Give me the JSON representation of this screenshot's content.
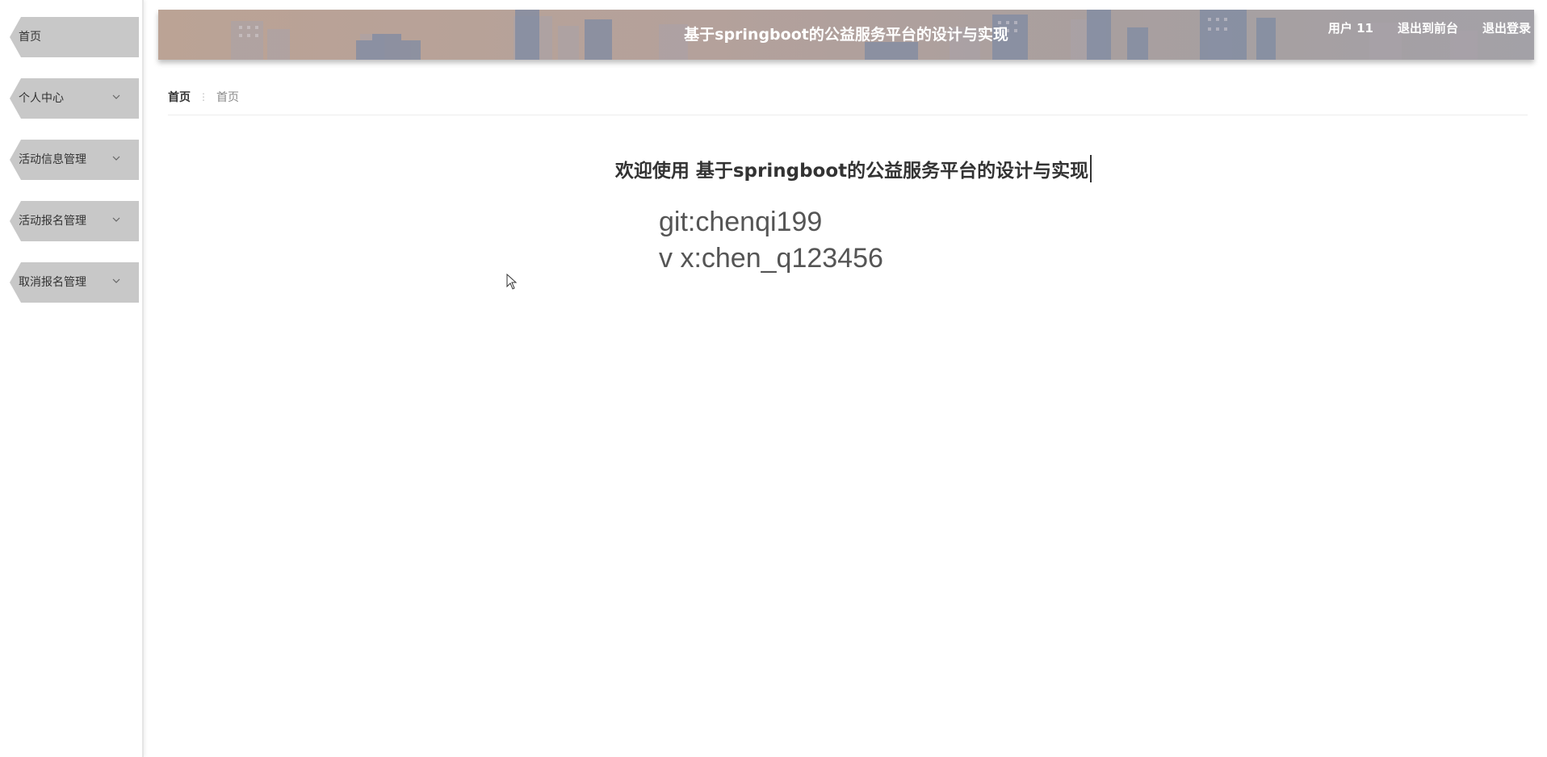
{
  "sidebar": {
    "items": [
      {
        "label": "首页",
        "expandable": false
      },
      {
        "label": "个人中心",
        "expandable": true
      },
      {
        "label": "活动信息管理",
        "expandable": true
      },
      {
        "label": "活动报名管理",
        "expandable": true
      },
      {
        "label": "取消报名管理",
        "expandable": true
      }
    ]
  },
  "header": {
    "title": "基于springboot的公益服务平台的设计与实现",
    "user_label": "用户 11",
    "back_to_front_label": "退出到前台",
    "logout_label": "退出登录"
  },
  "breadcrumb": {
    "home": "首页",
    "separator": "⋮",
    "current": "首页"
  },
  "main": {
    "welcome": "欢迎使用 基于springboot的公益服务平台的设计与实现",
    "contact_lines": [
      "git:chenqi199",
      "v x:chen_q123456"
    ]
  },
  "colors": {
    "menu_bg": "#c8c8c8",
    "header_bg": "#b4a19b",
    "text_dark": "#333333"
  }
}
